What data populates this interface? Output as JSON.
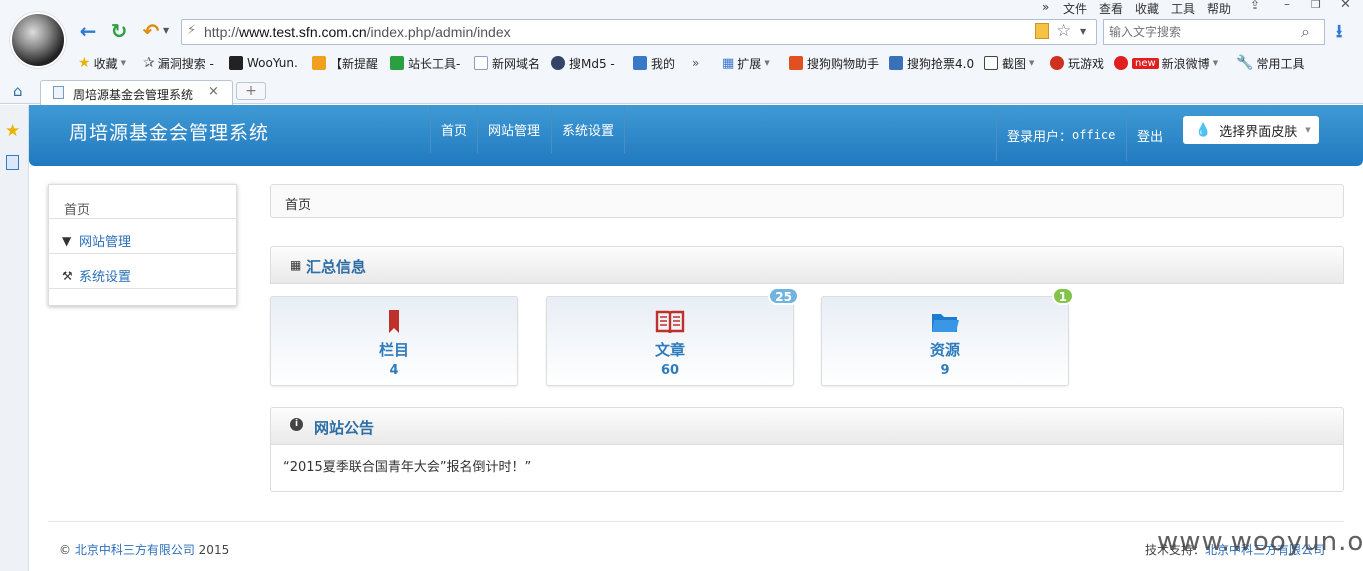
{
  "browser": {
    "url_prefix": "http://",
    "url_host": "www.test.sfn.com.cn",
    "url_path": "/index.php/admin/index",
    "search_placeholder": "输入文字搜索",
    "menu": [
      "文件",
      "查看",
      "收藏",
      "工具",
      "帮助"
    ],
    "bookmarks": [
      {
        "label": "收藏",
        "color": "#e8b400"
      },
      {
        "label": "漏洞搜索 -",
        "color": "#666666"
      },
      {
        "label": "WooYun.",
        "color": "#222222"
      },
      {
        "label": "【新提醒",
        "color": "#f0a020"
      },
      {
        "label": "站长工具-",
        "color": "#2aa040"
      },
      {
        "label": "新网域名",
        "color": "#8ba0c0"
      },
      {
        "label": "搜Md5 -",
        "color": "#334466"
      },
      {
        "label": "我的",
        "color": "#3a78c8"
      },
      {
        "label": "扩展",
        "color": "#3a78c8"
      },
      {
        "label": "搜狗购物助手",
        "color": "#e05020"
      },
      {
        "label": "搜狗抢票4.0",
        "color": "#3a70b8"
      },
      {
        "label": "截图",
        "color": "#444444"
      },
      {
        "label": "玩游戏",
        "color": "#d03020"
      },
      {
        "label": "新浪微博",
        "color": "#e02020"
      },
      {
        "label": "常用工具",
        "color": "#6a7a8a"
      }
    ],
    "new_badge": "new",
    "tab_title": "周培源基金会管理系统",
    "tab_close": "×",
    "new_tab": "+"
  },
  "app": {
    "title": "周培源基金会管理系统",
    "nav": [
      "首页",
      "网站管理",
      "系统设置"
    ],
    "login_label": "登录用户：",
    "login_user": "office",
    "logout": "登出",
    "skin_label": "选择界面皮肤"
  },
  "sidebar": {
    "header": "首页",
    "items": [
      {
        "label": "网站管理"
      },
      {
        "label": "系统设置"
      }
    ]
  },
  "breadcrumb": "首页",
  "summary": {
    "title": "汇总信息",
    "cards": [
      {
        "label": "栏目",
        "value": "4",
        "badge": null,
        "icon": "bookmark-icon",
        "color": "#c0302a"
      },
      {
        "label": "文章",
        "value": "60",
        "badge": "25",
        "badge_color": "#6fb3e0",
        "icon": "book-icon",
        "color": "#c0302a"
      },
      {
        "label": "资源",
        "value": "9",
        "badge": "1",
        "badge_color": "#82c44a",
        "icon": "folder-icon",
        "color": "#1f7bd0"
      }
    ]
  },
  "notice": {
    "title": "网站公告",
    "text": "“2015夏季联合国青年大会”报名倒计时！”"
  },
  "footer": {
    "copyright": "©",
    "company": "北京中科三方有限公司",
    "year": "2015",
    "support_label": "技术支持：",
    "support_company": "北京中科三方有限公司"
  },
  "watermark": "www.wooyun.org"
}
